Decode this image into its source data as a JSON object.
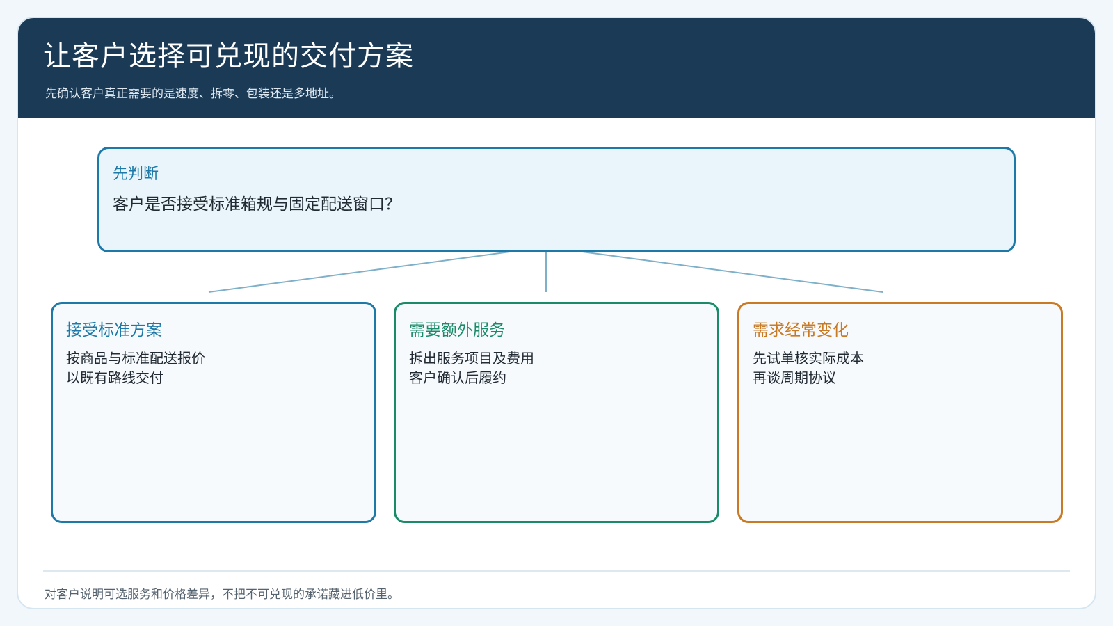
{
  "header": {
    "title": "让客户选择可兑现的交付方案",
    "subtitle": "先确认客户真正需要的是速度、拆零、包装还是多地址。"
  },
  "decision": {
    "label": "先判断",
    "question": "客户是否接受标准箱规与固定配送窗口？"
  },
  "options": [
    {
      "title": "接受标准方案",
      "lines": [
        "按商品与标准配送报价",
        "以既有路线交付"
      ],
      "color": "#1d79a7"
    },
    {
      "title": "需要额外服务",
      "lines": [
        "拆出服务项目及费用",
        "客户确认后履约"
      ],
      "color": "#1a8a68"
    },
    {
      "title": "需求经常变化",
      "lines": [
        "先试单核实际成本",
        "再谈周期协议"
      ],
      "color": "#c97a24"
    }
  ],
  "footer": {
    "note": "对客户说明可选服务和价格差异，不把不可兑现的承诺藏进低价里。"
  },
  "colors": {
    "header_bg": "#1b3a56",
    "connector": "#7fb0c9"
  }
}
